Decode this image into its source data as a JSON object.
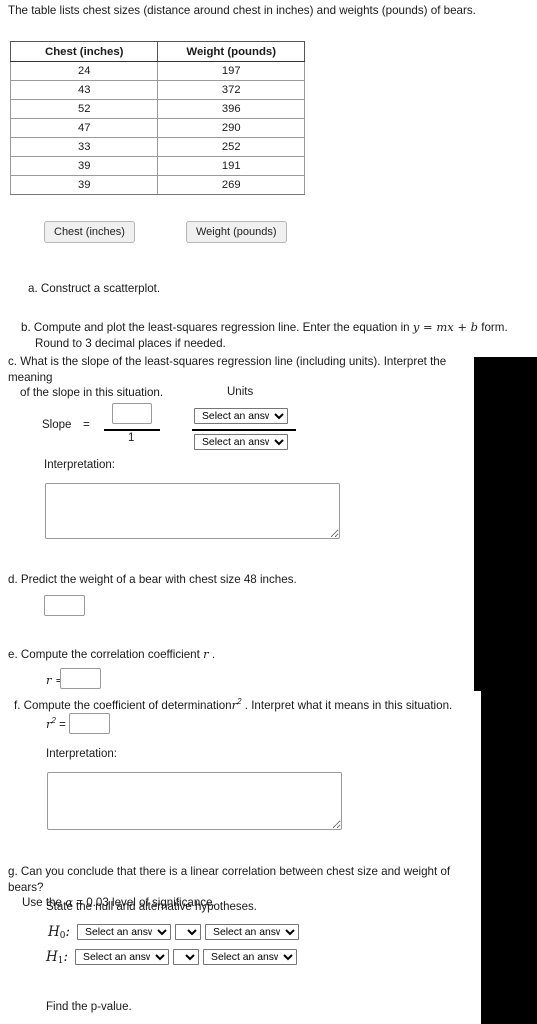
{
  "intro": {
    "text": "The table lists chest sizes (distance around chest in inches) and weights (pounds) of bears."
  },
  "table": {
    "headers": [
      "Chest (inches)",
      "Weight (pounds)"
    ],
    "rows": [
      [
        "24",
        "197"
      ],
      [
        "43",
        "372"
      ],
      [
        "52",
        "396"
      ],
      [
        "47",
        "290"
      ],
      [
        "33",
        "252"
      ],
      [
        "39",
        "191"
      ],
      [
        "39",
        "269"
      ]
    ]
  },
  "buttons": {
    "chest": "Chest (inches)",
    "weight": "Weight (pounds)"
  },
  "questions": {
    "a": "a. Construct a scatterplot.",
    "b_part1": "b. Compute and plot the least-squares regression line. Enter the equation in",
    "b_math": "y = mx + b",
    "b_part2": "form.",
    "b_line2": "Round to 3 decimal places if needed.",
    "c_line1": "c. What is the slope of the least-squares regression line (including units). Interpret the meaning",
    "c_line2": "of the slope in this situation.",
    "d": "d. Predict the weight of a bear with chest size 48 inches.",
    "e_part1": "e. Compute the correlation coefficient",
    "e_math": "r",
    "e_part2": ".",
    "f_part1": "f. Compute the coefficient of determination",
    "f_math": "r",
    "f_math_sup": "2",
    "f_part2": ". Interpret what it means in this situation.",
    "g_line1": "g. Can you conclude that there is a linear correlation between chest size and weight of bears?",
    "g_line2_pre": "Use the",
    "g_alpha": "α",
    "g_line2_post": "= 0.03 level of significance."
  },
  "slope": {
    "units_label": "Units",
    "slope_word": "Slope",
    "equals": "=",
    "numerator_value": "",
    "denominator": "1",
    "unit_select_top": "Select an answer",
    "unit_select_bottom": "Select an answer",
    "select_options": [
      "Select an answer"
    ]
  },
  "interpretation": {
    "label_c": "Interpretation:",
    "value_c": "",
    "label_f": "Interpretation:",
    "value_f": ""
  },
  "answers": {
    "d_value": "",
    "r_label": "r =",
    "r_value": "",
    "r2_label_base": "r",
    "r2_label_sup": "2",
    "r2_equals": "=",
    "r2_value": ""
  },
  "hypotheses": {
    "prompt": "State the null and alternative hypotheses.",
    "h0_symbol": "H",
    "h0_sub": "0",
    "h1_symbol": "H",
    "h1_sub": "1",
    "colon": ":",
    "select_placeholder": "Select an answer",
    "operator_placeholder": "?",
    "h0_left": "Select an answer",
    "h0_op": "?",
    "h0_right": "Select an answer",
    "h1_left": "Select an answer",
    "h1_op": "?",
    "h1_right": "Select an answer"
  },
  "footer": {
    "find_p_value": "Find the p-value."
  },
  "colors": {
    "page_background": "#ffffff",
    "text": "#1a1a1a",
    "table_border": "#9a9a9a",
    "button_background": "#f0f0f0",
    "button_border": "#b5b5b5",
    "input_border": "#9a9a9a",
    "overlay": "#000000"
  }
}
